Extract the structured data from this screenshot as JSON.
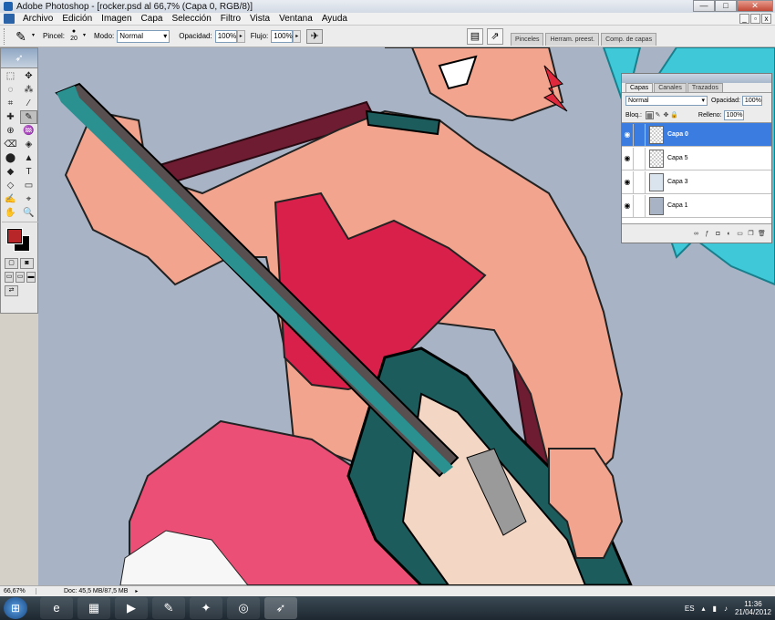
{
  "window": {
    "title": "Adobe Photoshop - [rocker.psd al 66,7% (Capa 0, RGB/8)]",
    "minimize": "—",
    "maximize": "□",
    "close": "✕"
  },
  "menu": {
    "items": [
      "Archivo",
      "Edición",
      "Imagen",
      "Capa",
      "Selección",
      "Filtro",
      "Vista",
      "Ventana",
      "Ayuda"
    ],
    "doc_min": "_",
    "doc_restore": "▫",
    "doc_close": "x"
  },
  "options": {
    "brush_label": "Pincel:",
    "brush_size": "20",
    "mode_label": "Modo:",
    "mode_value": "Normal",
    "opacity_label": "Opacidad:",
    "opacity_value": "100%",
    "flow_label": "Flujo:",
    "flow_value": "100%"
  },
  "palette_well": {
    "tabs": [
      "Pinceles",
      "Herram. preest.",
      "Comp. de capas"
    ]
  },
  "toolbox": {
    "tools": [
      "⬚",
      "✥",
      "◌",
      "⁂",
      "⌗",
      "⁄",
      "✚",
      "✎",
      "⊕",
      "♒",
      "⌫",
      "◈",
      "⬤",
      "▲",
      "◆",
      "T",
      "◇",
      "▭",
      "✍",
      "⌖",
      "✋",
      "🔍"
    ],
    "fg_color": "#b8262a",
    "bg_color": "#000000"
  },
  "layers_panel": {
    "tabs": [
      "Capas",
      "Canales",
      "Trazados"
    ],
    "blend_mode": "Normal",
    "opacity_label": "Opacidad:",
    "opacity_value": "100%",
    "lock_label": "Bloq.:",
    "fill_label": "Relleno:",
    "fill_value": "100%",
    "layers": [
      {
        "name": "Capa 0",
        "active": true,
        "thumb": "transparent"
      },
      {
        "name": "Capa 5",
        "active": false,
        "thumb": "transparent"
      },
      {
        "name": "Capa 3",
        "active": false,
        "thumb": "art"
      },
      {
        "name": "Capa 1",
        "active": false,
        "thumb": "blue"
      }
    ]
  },
  "status": {
    "zoom": "66,67%",
    "doc": "Doc: 45,5 MB/87,5 MB"
  },
  "taskbar": {
    "lang": "ES",
    "time": "11:36",
    "date": "21/04/2012"
  },
  "colors": {
    "canvas_bg": "#a8b4c6",
    "skin": "#f2a48e",
    "corset": "#d8204a",
    "skirt": "#ec4f76",
    "guitar": "#1c5c5c",
    "strap": "#6e1c32",
    "hair": "#3ec8d8",
    "selection": "#3a7ce0"
  }
}
